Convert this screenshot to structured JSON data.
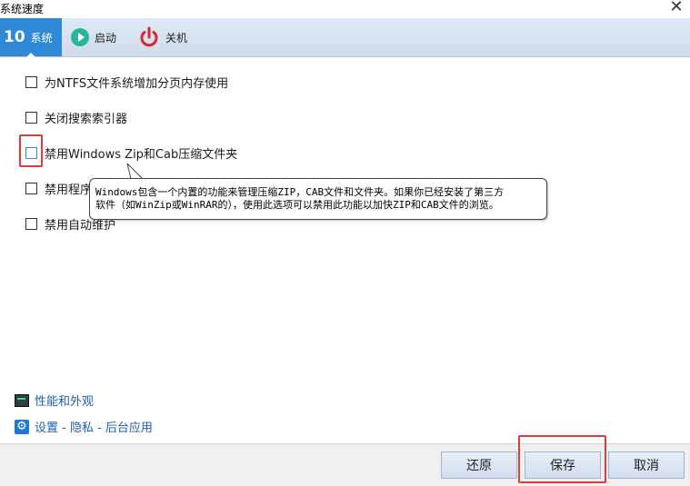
{
  "window": {
    "title": "系统速度",
    "close_glyph": "✕"
  },
  "tabs": [
    {
      "label": "系统",
      "icon": "ten-icon",
      "icon_text": "10",
      "active": true
    },
    {
      "label": "启动",
      "icon": "play-icon",
      "active": false
    },
    {
      "label": "关机",
      "icon": "power-icon",
      "active": false
    }
  ],
  "options": [
    {
      "label": "为NTFS文件系统增加分页内存使用",
      "checked": false
    },
    {
      "label": "关闭搜索索引器",
      "checked": false
    },
    {
      "label": "禁用Windows Zip和Cab压缩文件夹",
      "checked": false
    },
    {
      "label": "禁用程序",
      "checked": false
    },
    {
      "label": "禁用自动维护",
      "checked": false
    }
  ],
  "tooltip": {
    "line1": "Windows包含一个内置的功能来管理压缩ZIP，CAB文件和文件夹。如果你已经安装了第三方",
    "line2": "软件（如WinZip或WinRAR的），使用此选项可以禁用此功能以加快ZIP和CAB文件的浏览。"
  },
  "links": [
    {
      "label": "性能和外观",
      "icon": "performance-icon"
    },
    {
      "label": "设置 - 隐私 - 后台应用",
      "icon": "settings-gear-icon"
    }
  ],
  "footer": {
    "restore_label": "还原",
    "save_label": "保存",
    "cancel_label": "取消"
  },
  "colors": {
    "accent": "#2e89d6",
    "highlight": "#e23a3a",
    "link": "#1f5fa8",
    "play": "#27b59d",
    "power": "#d9262c"
  }
}
